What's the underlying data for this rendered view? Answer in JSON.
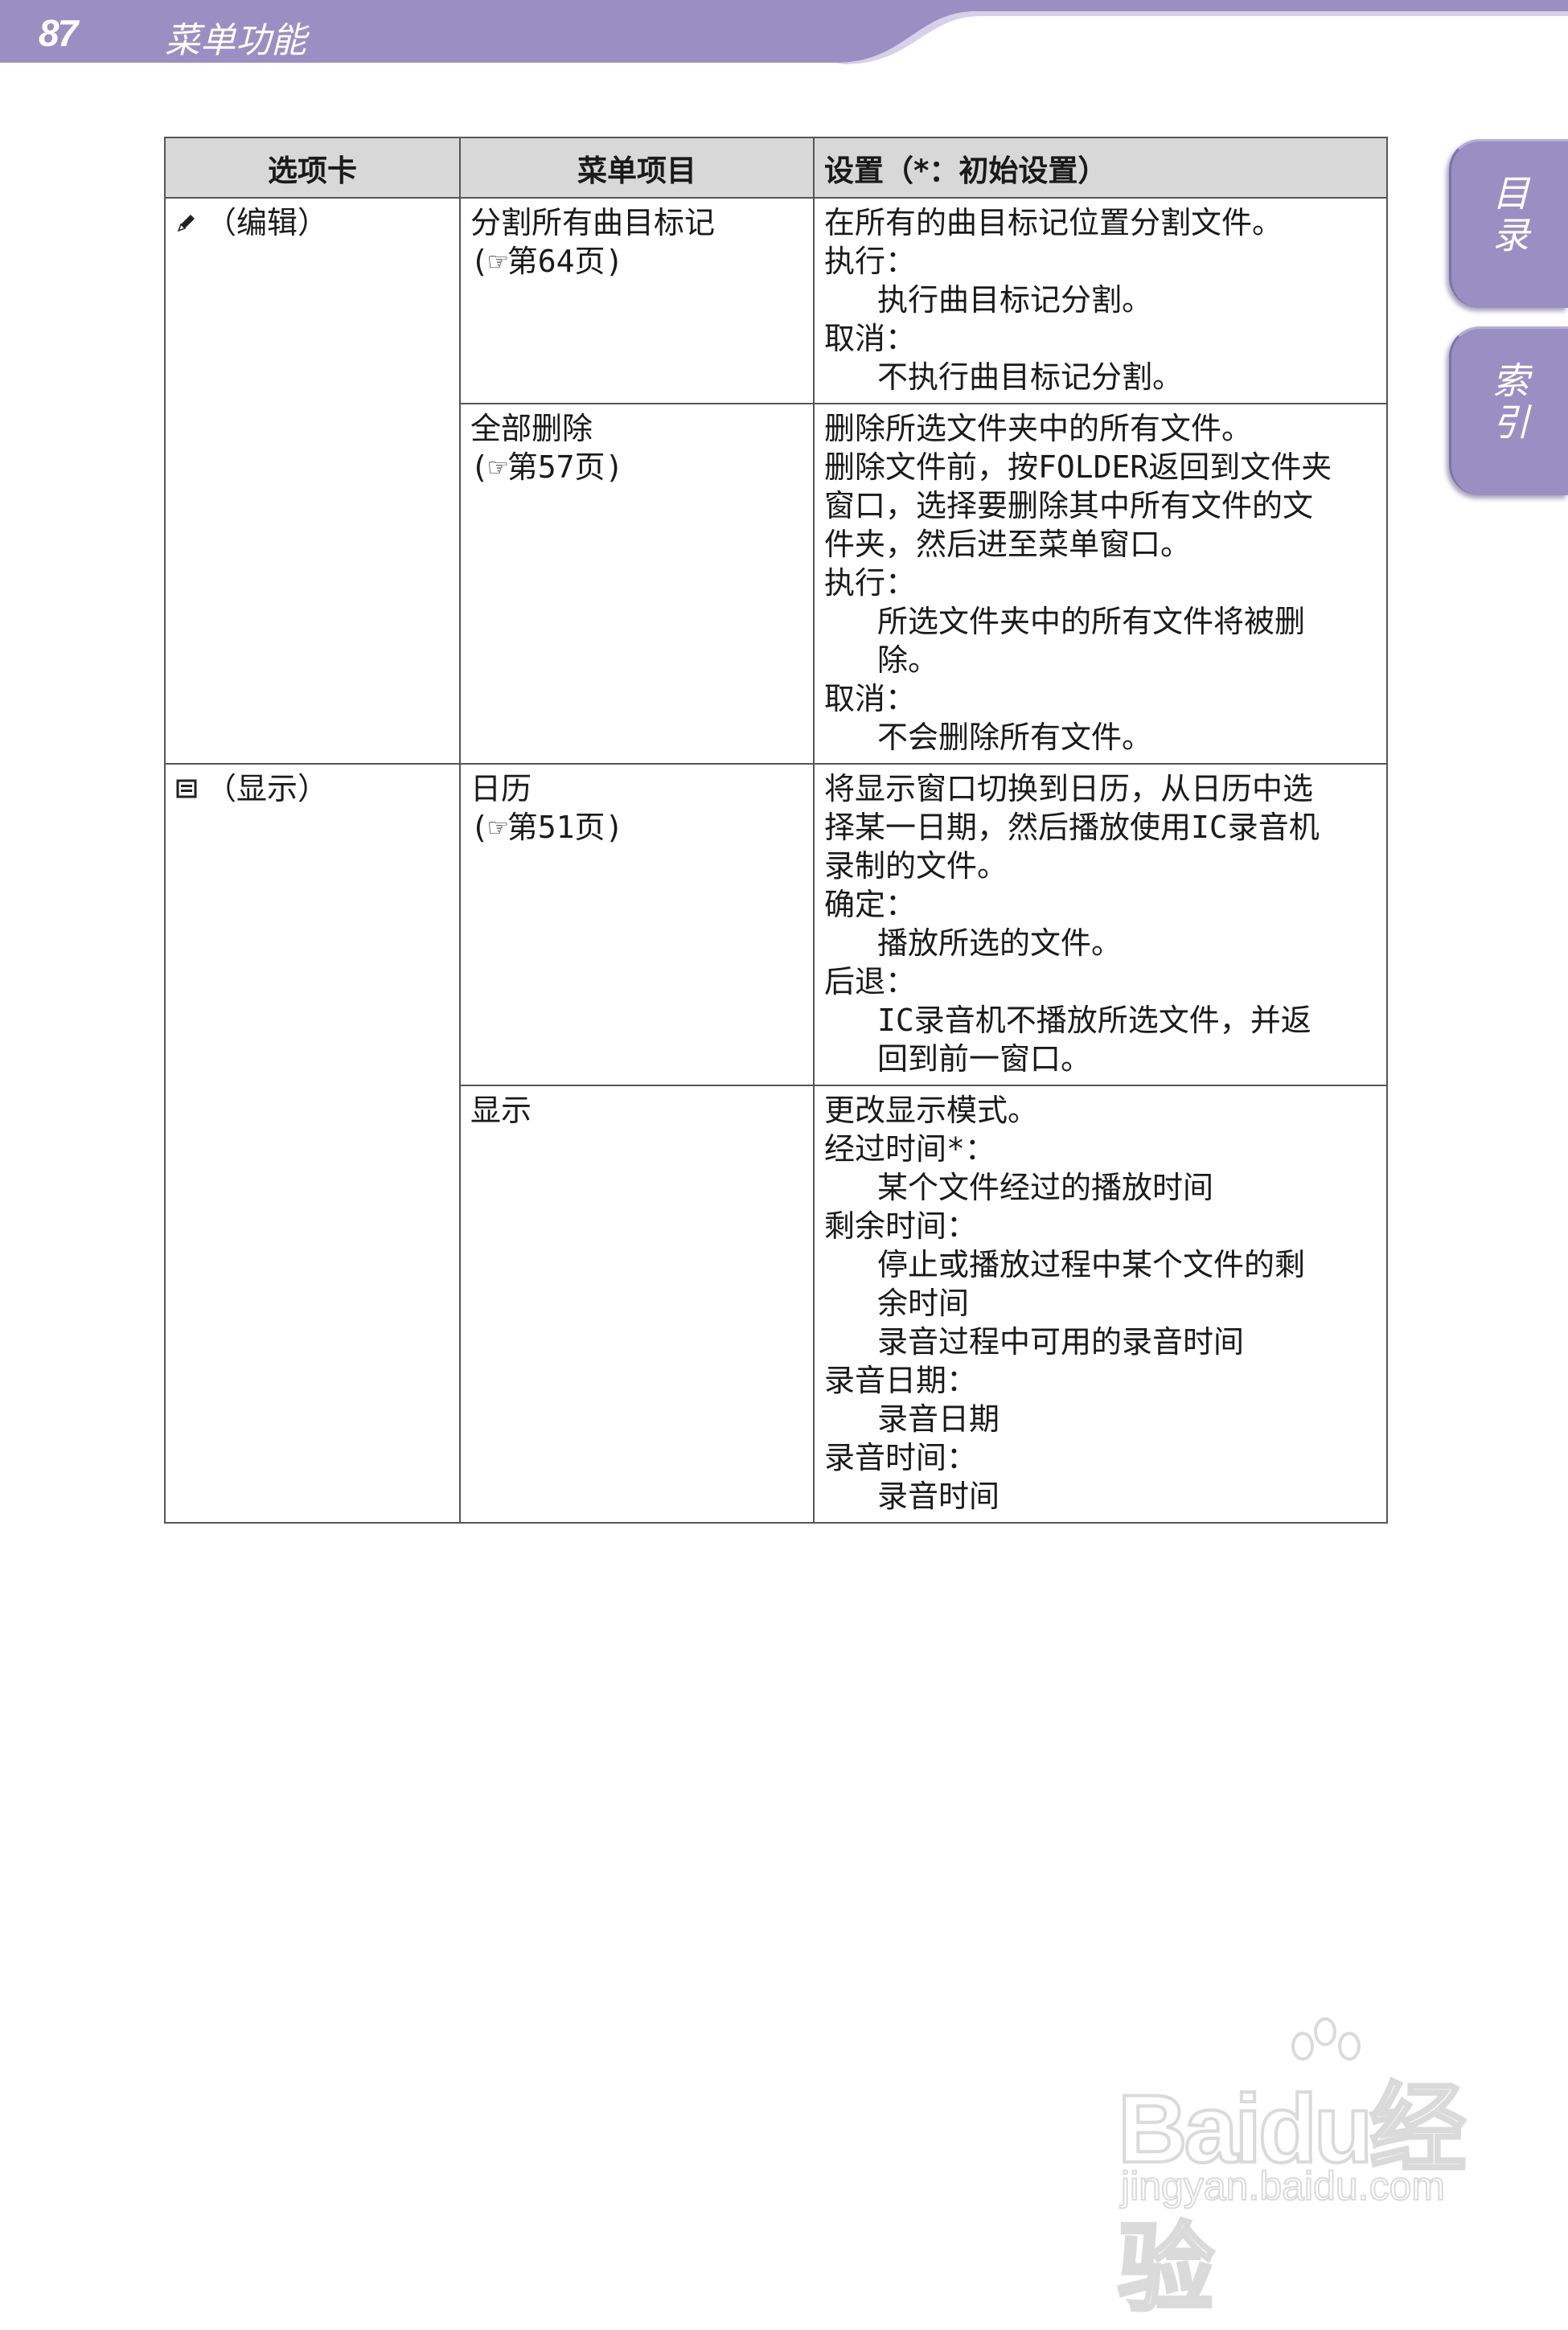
{
  "header": {
    "page_number": "87",
    "section_title": "菜单功能"
  },
  "side_tabs": {
    "toc": "目录",
    "index": "索引"
  },
  "table": {
    "headers": [
      "选项卡",
      "菜单项目",
      "设置（*：初始设置）"
    ],
    "edit_tab": "（编辑）",
    "display_tab": "（显示）",
    "rows": [
      {
        "item": [
          "分割所有曲目标记",
          "(☞第64页)"
        ],
        "lines": [
          {
            "t": "在所有的曲目标记位置分割文件。",
            "i": false
          },
          {
            "t": "执行：",
            "i": false
          },
          {
            "t": "执行曲目标记分割。",
            "i": true
          },
          {
            "t": "取消：",
            "i": false
          },
          {
            "t": "不执行曲目标记分割。",
            "i": true
          }
        ]
      },
      {
        "item": [
          "全部删除",
          "(☞第57页)"
        ],
        "lines": [
          {
            "t": "删除所选文件夹中的所有文件。",
            "i": false
          },
          {
            "t": "删除文件前，按FOLDER返回到文件夹",
            "i": false
          },
          {
            "t": "窗口，选择要删除其中所有文件的文",
            "i": false
          },
          {
            "t": "件夹，然后进至菜单窗口。",
            "i": false
          },
          {
            "t": "执行：",
            "i": false
          },
          {
            "t": "所选文件夹中的所有文件将被删",
            "i": true
          },
          {
            "t": "除。",
            "i": true
          },
          {
            "t": "取消：",
            "i": false
          },
          {
            "t": "不会删除所有文件。",
            "i": true
          }
        ]
      },
      {
        "item": [
          "日历",
          "(☞第51页)"
        ],
        "lines": [
          {
            "t": "将显示窗口切换到日历，从日历中选",
            "i": false
          },
          {
            "t": "择某一日期，然后播放使用IC录音机",
            "i": false
          },
          {
            "t": "录制的文件。",
            "i": false
          },
          {
            "t": "确定：",
            "i": false
          },
          {
            "t": "播放所选的文件。",
            "i": true
          },
          {
            "t": "后退：",
            "i": false
          },
          {
            "t": "IC录音机不播放所选文件，并返",
            "i": true
          },
          {
            "t": "回到前一窗口。",
            "i": true
          }
        ]
      },
      {
        "item": [
          "显示"
        ],
        "lines": [
          {
            "t": "更改显示模式。",
            "i": false
          },
          {
            "t": "经过时间*：",
            "i": false
          },
          {
            "t": "某个文件经过的播放时间",
            "i": true
          },
          {
            "t": "剩余时间：",
            "i": false
          },
          {
            "t": "停止或播放过程中某个文件的剩",
            "i": true
          },
          {
            "t": "余时间",
            "i": true
          },
          {
            "t": "录音过程中可用的录音时间",
            "i": true
          },
          {
            "t": "录音日期：",
            "i": false
          },
          {
            "t": "录音日期",
            "i": true
          },
          {
            "t": "录音时间：",
            "i": false
          },
          {
            "t": "录音时间",
            "i": true
          }
        ]
      }
    ]
  },
  "watermark": {
    "brand": "Baidu经验",
    "url": "jingyan.baidu.com"
  },
  "colors": {
    "header_bg": "#9a8fc3",
    "header_light": "#d6d1e8",
    "table_header_bg": "#d8d8d8"
  }
}
